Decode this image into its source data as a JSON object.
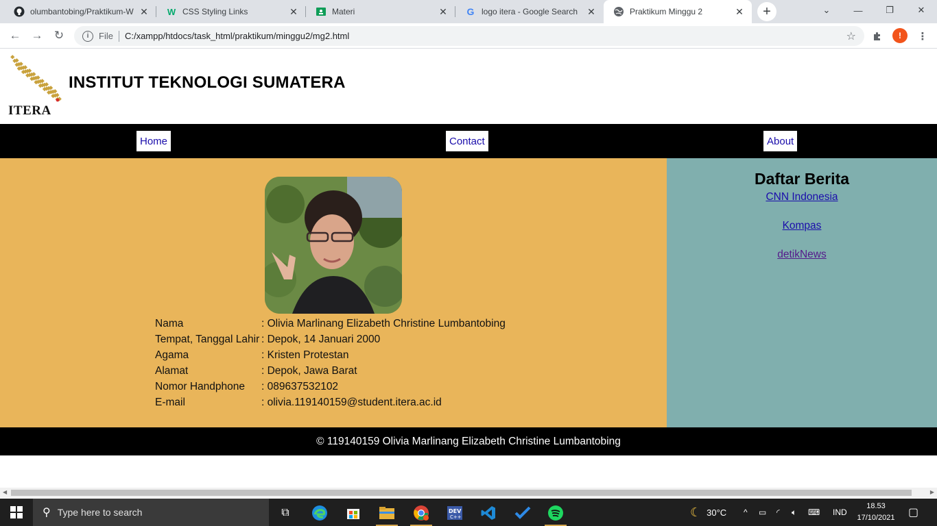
{
  "browser": {
    "tabs": [
      {
        "title": "olumbantobing/Praktikum-W",
        "icon": "github-icon",
        "active": false
      },
      {
        "title": "CSS Styling Links",
        "icon": "w3schools-icon",
        "active": false
      },
      {
        "title": "Materi",
        "icon": "classroom-icon",
        "active": false
      },
      {
        "title": "logo itera - Google Search",
        "icon": "google-icon",
        "active": false
      },
      {
        "title": "Praktikum Minggu 2",
        "icon": "globe-icon",
        "active": true
      }
    ],
    "address": {
      "scheme": "File",
      "url": "C:/xampp/htdocs/task_html/praktikum/minggu2/mg2.html"
    },
    "profile_initial": "!"
  },
  "page": {
    "header": {
      "logo_text": "ITERA",
      "title": "INSTITUT TEKNOLOGI SUMATERA"
    },
    "nav": {
      "home": "Home",
      "contact": "Contact",
      "about": "About"
    },
    "bio": [
      {
        "label": "Nama",
        "value": ": Olivia Marlinang Elizabeth Christine Lumbantobing"
      },
      {
        "label": "Tempat, Tanggal Lahir",
        "value": ": Depok, 14 Januari 2000"
      },
      {
        "label": "Agama",
        "value": ": Kristen Protestan"
      },
      {
        "label": "Alamat",
        "value": ": Depok, Jawa Barat"
      },
      {
        "label": "Nomor Handphone",
        "value": ": 089637532102"
      },
      {
        "label": "E-mail",
        "value": ": olivia.119140159@student.itera.ac.id"
      }
    ],
    "sidebar": {
      "title": "Daftar Berita",
      "links": [
        "CNN Indonesia",
        "Kompas",
        "detikNews"
      ]
    },
    "footer": "© 119140159 Olivia Marlinang Elizabeth Christine Lumbantobing"
  },
  "taskbar": {
    "search_placeholder": "Type here to search",
    "weather": "30°C",
    "language": "IND",
    "time": "18.53",
    "date": "17/10/2021"
  },
  "colors": {
    "main_bg": "#e9b55a",
    "sidebar_bg": "#80afae",
    "nav_bg": "#000000",
    "logo_gold": "#c9a23d"
  }
}
